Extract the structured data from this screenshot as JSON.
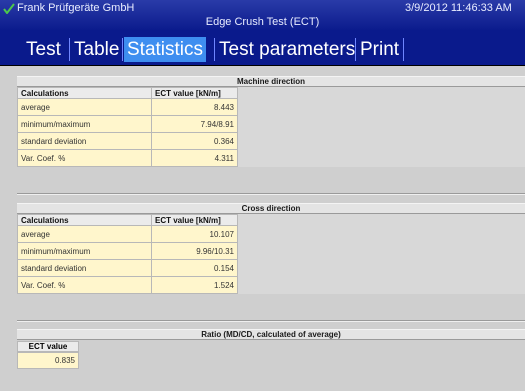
{
  "window": {
    "company": "Frank Prüfgeräte GmbH",
    "title": "Edge Crush Test (ECT)",
    "datetime": "3/9/2012 11:46:33 AM",
    "check_icon": "checkmark-icon",
    "check_color": "#4cc84c"
  },
  "menu": {
    "tabs": [
      {
        "label": "Test"
      },
      {
        "label": "Table"
      },
      {
        "label": "Statistics",
        "active": true
      },
      {
        "label": "Test parameters"
      },
      {
        "label": "Print"
      }
    ],
    "accent": "#3e8ef0",
    "background": "#0a1a8c"
  },
  "machine_direction": {
    "title": "Machine direction",
    "headers": [
      "Calculations",
      "ECT value [kN/m]"
    ],
    "rows": [
      [
        "average",
        "8.443"
      ],
      [
        "minimum/maximum",
        "7.94/8.91"
      ],
      [
        "standard deviation",
        "0.364"
      ],
      [
        "Var. Coef. %",
        "4.311"
      ]
    ]
  },
  "cross_direction": {
    "title": "Cross direction",
    "headers": [
      "Calculations",
      "ECT value [kN/m]"
    ],
    "rows": [
      [
        "average",
        "10.107"
      ],
      [
        "minimum/maximum",
        "9.96/10.31"
      ],
      [
        "standard deviation",
        "0.154"
      ],
      [
        "Var. Coef. %",
        "1.524"
      ]
    ]
  },
  "ratio": {
    "title": "Ratio (MD/CD, calculated of average)",
    "header": "ECT value [kN/m]",
    "value": "0.835"
  }
}
